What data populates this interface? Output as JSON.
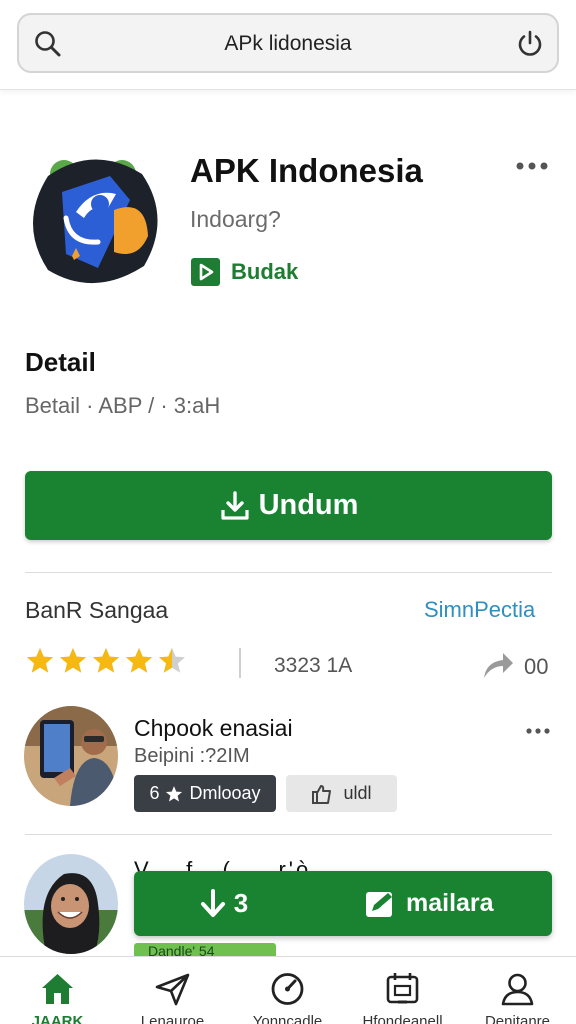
{
  "search": {
    "query": "APk lidonesia"
  },
  "app": {
    "title": "APK Indonesia",
    "subtitle": "Indoarg?",
    "badge_label": "Budak"
  },
  "detail": {
    "title": "Detail",
    "meta": "Betail · ABP  / · 3:aH"
  },
  "install": {
    "label": "Undum"
  },
  "reviews": {
    "title": "BanR Sangaa",
    "link": "SimnPectia",
    "rating": 4.5,
    "rating_max": 5,
    "count": "3323 1A",
    "share_count": "00"
  },
  "comments": [
    {
      "name": "Chpook enasiai",
      "meta": "Beipini :?2IM",
      "chip_dark_prefix": "6",
      "chip_dark_label": "Dmlooay",
      "chip_light_label": "uldl"
    },
    {
      "name": "V... f.. ( ... r'ò",
      "tag": "Dandle' 54"
    }
  ],
  "float_bar": {
    "left_label": "3",
    "right_label": "mailara"
  },
  "nav": {
    "items": [
      {
        "label": "JAARK",
        "icon": "home-icon"
      },
      {
        "label": "Lenauroe",
        "icon": "send-icon"
      },
      {
        "label": "Yonncadle",
        "icon": "gauge-icon"
      },
      {
        "label": "Hfondeanell",
        "icon": "calendar-icon"
      },
      {
        "label": "Denitanre",
        "icon": "person-icon"
      }
    ]
  },
  "colors": {
    "accent": "#198332",
    "star": "#f6b813",
    "link": "#2f8fbf"
  }
}
